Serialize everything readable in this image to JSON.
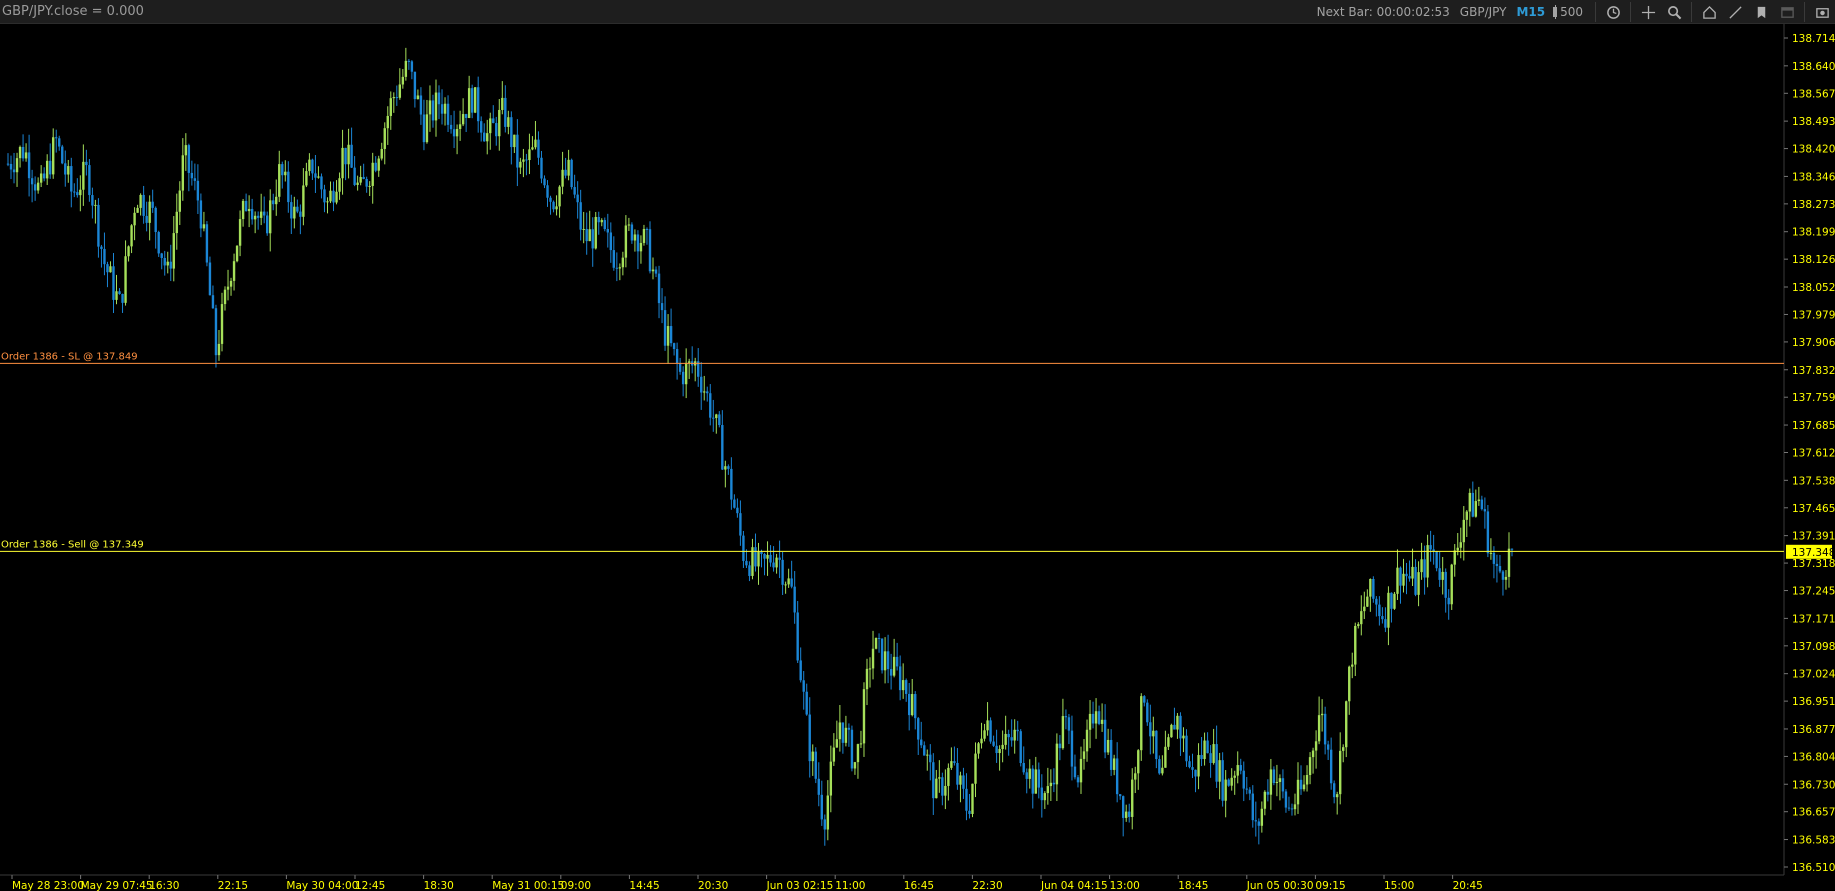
{
  "toolbar": {
    "indicator": "GBP/JPY.close = 0.000",
    "next_bar": "Next Bar: 00:00:02:53",
    "symbol": "GBP/JPY",
    "timeframe": "M15",
    "bars_count": "500",
    "icons": [
      "sync-icon",
      "crosshair-icon",
      "zoom-icon",
      "home-icon",
      "draw-line-icon",
      "bookmark-icon",
      "window-icon",
      "screenshot-icon"
    ]
  },
  "colors": {
    "background": "#000000",
    "bull_candle": "#a6e05a",
    "bear_candle": "#1b86d6",
    "axis_text": "#ffff00",
    "sl_line": "#ff9040",
    "sell_line": "#ffff33",
    "current_price_bg": "#ffff00"
  },
  "orders": [
    {
      "label": "Order 1386 - SL @ 137.849",
      "price": 137.849,
      "color": "#ff9040"
    },
    {
      "label": "Order 1386 - Sell @ 137.349",
      "price": 137.349,
      "color": "#ffff33"
    }
  ],
  "current_price": "137.348",
  "chart_data": {
    "type": "candlestick",
    "symbol": "GBP/JPY",
    "timeframe": "M15",
    "ylim": [
      136.49,
      138.73
    ],
    "y_ticks": [
      "138.714",
      "138.640",
      "138.567",
      "138.493",
      "138.420",
      "138.346",
      "138.273",
      "138.199",
      "138.126",
      "138.052",
      "137.979",
      "137.906",
      "137.832",
      "137.759",
      "137.685",
      "137.612",
      "137.538",
      "137.465",
      "137.391",
      "137.318",
      "137.245",
      "137.171",
      "137.098",
      "137.024",
      "136.951",
      "136.877",
      "136.804",
      "136.730",
      "136.657",
      "136.583",
      "136.510"
    ],
    "x_ticks": [
      "May 28 23:00",
      "May 29 07:45",
      "16:30",
      "22:15",
      "May 30 04:00",
      "12:45",
      "18:30",
      "May 31 00:15",
      "09:00",
      "14:45",
      "20:30",
      "Jun 03 02:15",
      "11:00",
      "16:45",
      "22:30",
      "Jun 04 04:15",
      "13:00",
      "18:45",
      "Jun 05 00:30",
      "09:15",
      "15:00",
      "20:45"
    ],
    "price_path": [
      138.38,
      138.42,
      138.3,
      138.44,
      138.3,
      138.36,
      138.12,
      138.0,
      138.3,
      138.25,
      138.08,
      138.4,
      138.27,
      137.88,
      138.12,
      138.3,
      138.2,
      138.36,
      138.23,
      138.38,
      138.27,
      138.42,
      138.3,
      138.4,
      138.55,
      138.64,
      138.48,
      138.55,
      138.49,
      138.56,
      138.45,
      138.52,
      138.36,
      138.42,
      138.28,
      138.36,
      138.18,
      138.2,
      138.13,
      138.21,
      138.16,
      137.94,
      137.82,
      137.85,
      137.72,
      137.55,
      137.34,
      137.3,
      137.35,
      137.24,
      136.85,
      136.64,
      136.9,
      136.78,
      137.1,
      137.05,
      137.0,
      136.87,
      136.7,
      136.78,
      136.66,
      136.92,
      136.82,
      136.86,
      136.74,
      136.7,
      136.9,
      136.74,
      136.96,
      136.78,
      136.64,
      136.98,
      136.72,
      136.92,
      136.75,
      136.85,
      136.72,
      136.8,
      136.6,
      136.78,
      136.66,
      136.72,
      136.93,
      136.7,
      137.08,
      137.24,
      137.18,
      137.3,
      137.26,
      137.36,
      137.24,
      137.45,
      137.49,
      137.28,
      137.35
    ]
  }
}
